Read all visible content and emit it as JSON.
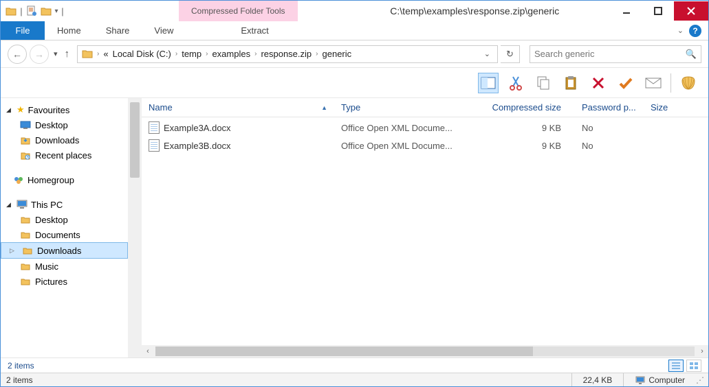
{
  "window": {
    "title": "C:\\temp\\examples\\response.zip\\generic",
    "context_tab": "Compressed Folder Tools"
  },
  "ribbon": {
    "file": "File",
    "tabs": [
      "Home",
      "Share",
      "View"
    ],
    "extract": "Extract"
  },
  "breadcrumbs": {
    "prefix": "«",
    "items": [
      "Local Disk (C:)",
      "temp",
      "examples",
      "response.zip",
      "generic"
    ]
  },
  "search": {
    "placeholder": "Search generic"
  },
  "sidebar": {
    "favourites": {
      "label": "Favourites",
      "items": [
        "Desktop",
        "Downloads",
        "Recent places"
      ]
    },
    "homegroup": {
      "label": "Homegroup"
    },
    "thispc": {
      "label": "This PC",
      "items": [
        "Desktop",
        "Documents",
        "Downloads",
        "Music",
        "Pictures"
      ],
      "selected_index": 2
    }
  },
  "columns": {
    "name": "Name",
    "type": "Type",
    "csize": "Compressed size",
    "pwd": "Password p...",
    "size": "Size"
  },
  "files": [
    {
      "name": "Example3A.docx",
      "type": "Office Open XML Docume...",
      "csize": "9 KB",
      "pwd": "No"
    },
    {
      "name": "Example3B.docx",
      "type": "Office Open XML Docume...",
      "csize": "9 KB",
      "pwd": "No"
    }
  ],
  "footer": {
    "count_short": "2 items",
    "count_status": "2 items",
    "total_size": "22,4 KB",
    "location": "Computer"
  }
}
